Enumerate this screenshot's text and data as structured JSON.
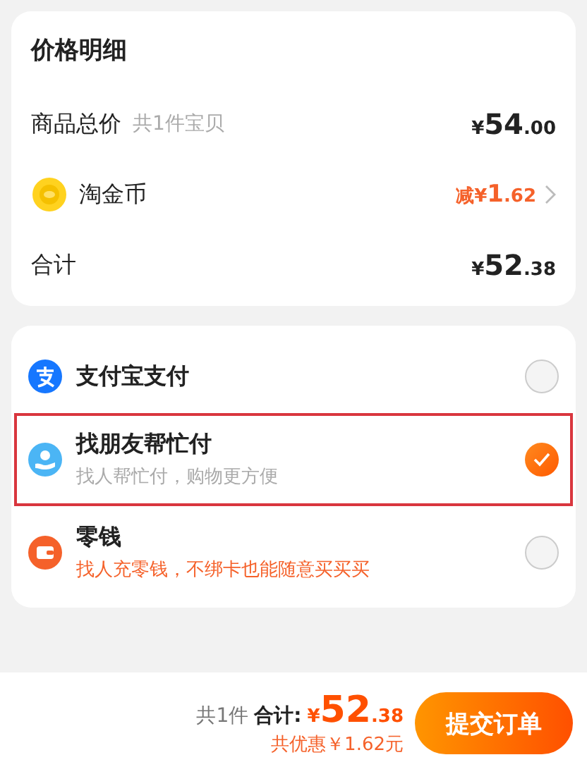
{
  "price_detail": {
    "title": "价格明细",
    "rows": [
      {
        "kind": "plain",
        "label": "商品总价",
        "note": "共1件宝贝",
        "amount": "¥54.00"
      },
      {
        "kind": "coin",
        "label": "淘金币",
        "amount": "减¥1.62",
        "discount": true
      },
      {
        "kind": "plain",
        "label": "合计",
        "amount": "¥52.38"
      }
    ]
  },
  "payment_methods": [
    {
      "kind": "alipay",
      "name": "支付宝支付",
      "selected": false,
      "highlighted": false
    },
    {
      "kind": "friend",
      "name": "找朋友帮忙付",
      "hint": "找人帮忙付，购物更方便",
      "hint_accent": false,
      "selected": true,
      "highlighted": true
    },
    {
      "kind": "wallet",
      "name": "零钱",
      "hint": "找人充零钱，不绑卡也能随意买买买",
      "hint_accent": true,
      "selected": false,
      "highlighted": false
    }
  ],
  "footer": {
    "count": "共1件",
    "total_label": "合计:",
    "total": "¥52.38",
    "saving": "共优惠￥1.62元",
    "submit": "提交订单"
  }
}
